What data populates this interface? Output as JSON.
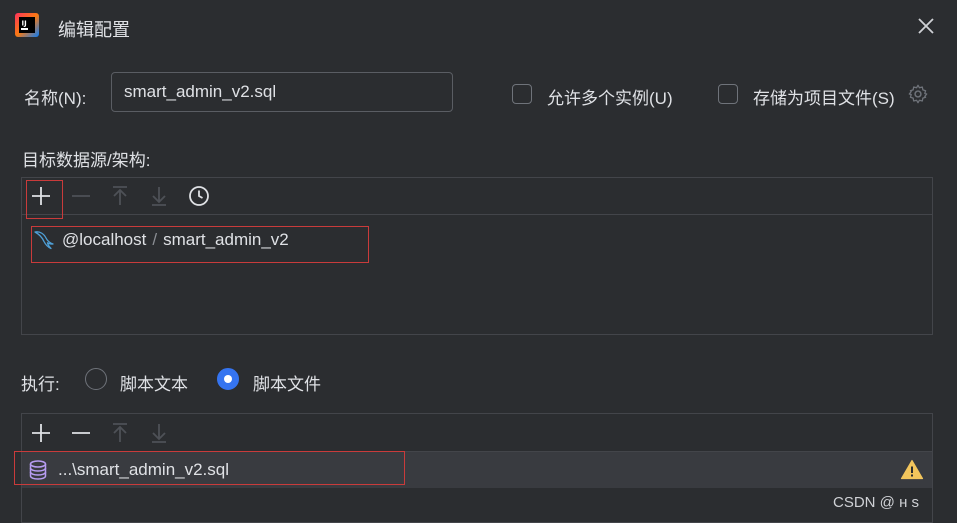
{
  "window": {
    "title": "编辑配置"
  },
  "name_field": {
    "label": "名称(N):",
    "value": "smart_admin_v2.sql"
  },
  "options": {
    "allow_multiple": "允许多个实例(U)",
    "store_as_project_file": "存储为项目文件(S)"
  },
  "target": {
    "label": "目标数据源/架构:",
    "source_host": "@localhost",
    "source_sep": "/",
    "source_schema": "smart_admin_v2"
  },
  "execute": {
    "label": "执行:",
    "options": [
      "脚本文本",
      "脚本文件"
    ],
    "selected": "脚本文件"
  },
  "script_files": {
    "items": [
      {
        "path": "...\\smart_admin_v2.sql",
        "warning": true
      }
    ]
  },
  "watermark": "CSDN @ н   s",
  "colors": {
    "background": "#2b2d30",
    "accent": "#3574f0",
    "highlight_box": "#c93b3b",
    "warning": "#f2c55c",
    "mysql_icon": "#4e9fd6",
    "db_icon": "#b79df2"
  },
  "icons": {
    "logo": "jetbrains-ide-logo-icon",
    "close": "close-icon",
    "add": "plus-icon",
    "remove": "minus-icon",
    "move_up": "arrow-up-icon",
    "move_down": "arrow-down-icon",
    "history": "clock-icon",
    "datasource": "mysql-dolphin-icon",
    "file": "database-file-icon",
    "warning": "warning-icon",
    "settings": "gear-icon"
  }
}
